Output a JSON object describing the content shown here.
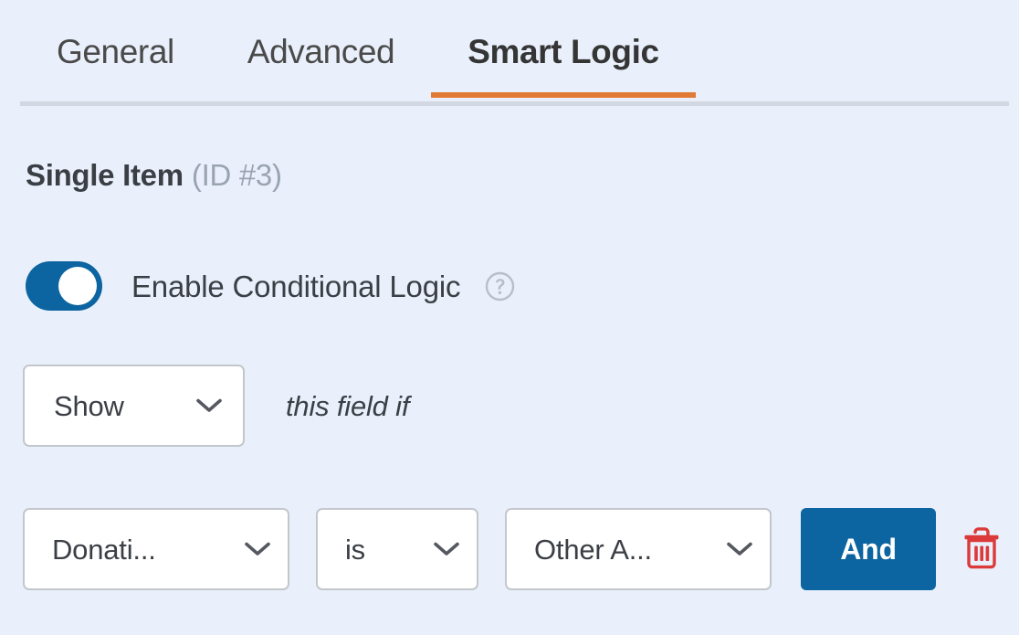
{
  "colors": {
    "page_bg": "#e9f0fb",
    "accent_orange": "#e07a35",
    "accent_blue": "#0c64a0",
    "danger_red": "#dc3a3a",
    "text_dark": "#3b3f45",
    "text_muted": "#9aa4b1",
    "border_gray": "#c3c7cc",
    "divider": "#d2d8e2"
  },
  "tabs": [
    {
      "label": "General",
      "active": false
    },
    {
      "label": "Advanced",
      "active": false
    },
    {
      "label": "Smart Logic",
      "active": true
    }
  ],
  "field": {
    "name": "Single Item",
    "id_label": "(ID #3)"
  },
  "conditional_logic": {
    "toggle_label": "Enable Conditional Logic",
    "toggle_state": "on",
    "help_icon": "question-circle-icon",
    "action_select": {
      "value": "Show",
      "chevron": "chevron-down-icon"
    },
    "sentence_text": "this field if",
    "rule": {
      "field_select": {
        "value": "Donati...",
        "chevron": "chevron-down-icon"
      },
      "operator_select": {
        "value": "is",
        "chevron": "chevron-down-icon"
      },
      "value_select": {
        "value": "Other A...",
        "chevron": "chevron-down-icon"
      },
      "and_button_label": "And",
      "delete_icon": "trash-icon"
    }
  }
}
